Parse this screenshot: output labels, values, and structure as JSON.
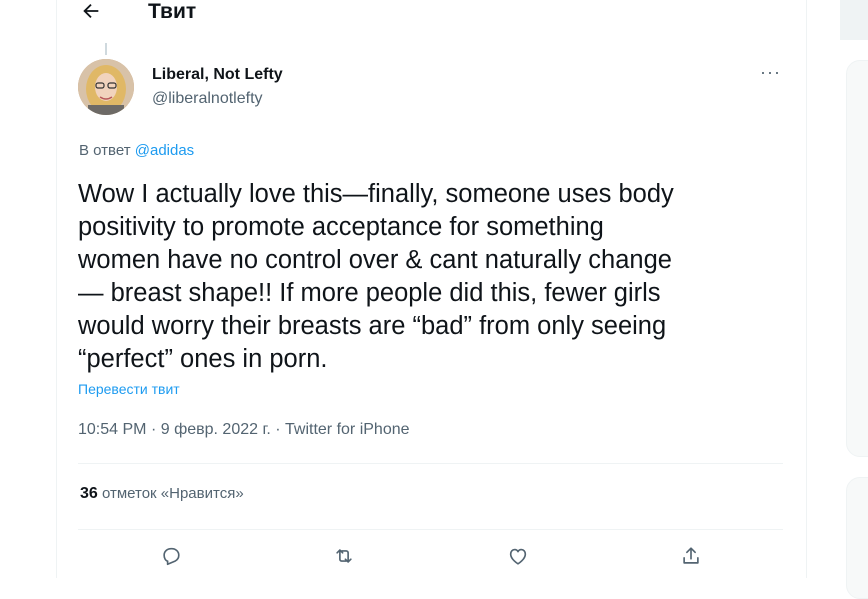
{
  "header": {
    "back_icon": "arrow-left-icon",
    "title": "Твит"
  },
  "tweet": {
    "author": {
      "display_name": "Liberal, Not Lefty",
      "handle": "@liberalnotlefty"
    },
    "more_icon": "ellipsis-icon",
    "more_label": "···",
    "reply_prefix": "В ответ",
    "reply_to": "@adidas",
    "text": "Wow I actually love this—finally, someone uses body\npositivity to promote acceptance for something\nwomen have no control over & cant naturally change\n— breast shape!! If more people did this, fewer girls\nwould worry their breasts are “bad” from only seeing\n“perfect” ones in porn.",
    "translate_label": "Перевести твит",
    "time": "10:54 PM",
    "date": "9 февр. 2022 г.",
    "source": "Twitter for iPhone",
    "separator": "·",
    "likes_count": "36",
    "likes_label": "отметок «Нравится»"
  },
  "actions": [
    {
      "icon": "reply-icon"
    },
    {
      "icon": "retweet-icon"
    },
    {
      "icon": "heart-icon"
    },
    {
      "icon": "share-icon"
    }
  ],
  "colors": {
    "accent": "#1d9bf0",
    "text": "#0f1419",
    "secondary": "#536471",
    "border": "#eff3f4"
  }
}
